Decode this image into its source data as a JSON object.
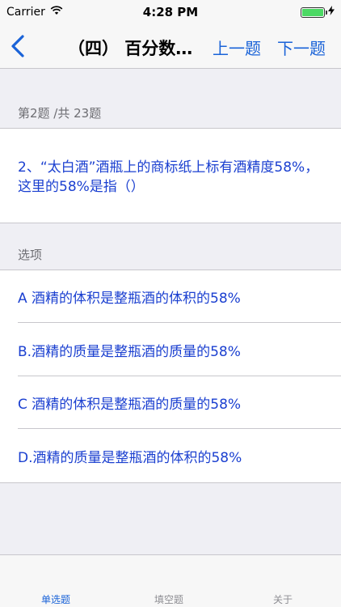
{
  "status_bar": {
    "carrier": "Carrier",
    "time": "4:28 PM"
  },
  "nav": {
    "title": "（四） 百分数…",
    "prev_label": "上一题",
    "next_label": "下一题",
    "accent": "#1a63d8"
  },
  "question": {
    "counter": "第2题 /共 23题",
    "text": "2、“太白酒”酒瓶上的商标纸上标有酒精度58%，这里的58%是指（）"
  },
  "options": {
    "header": "选项",
    "items": [
      "A 酒精的体积是整瓶酒的体积的58%",
      "B.酒精的质量是整瓶酒的质量的58%",
      "C 酒精的体积是整瓶酒的质量的58%",
      "D.酒精的质量是整瓶酒的体积的58%"
    ]
  },
  "tabs": [
    {
      "label": "单选题",
      "active": true
    },
    {
      "label": "填空题",
      "active": false
    },
    {
      "label": "关于",
      "active": false
    }
  ]
}
